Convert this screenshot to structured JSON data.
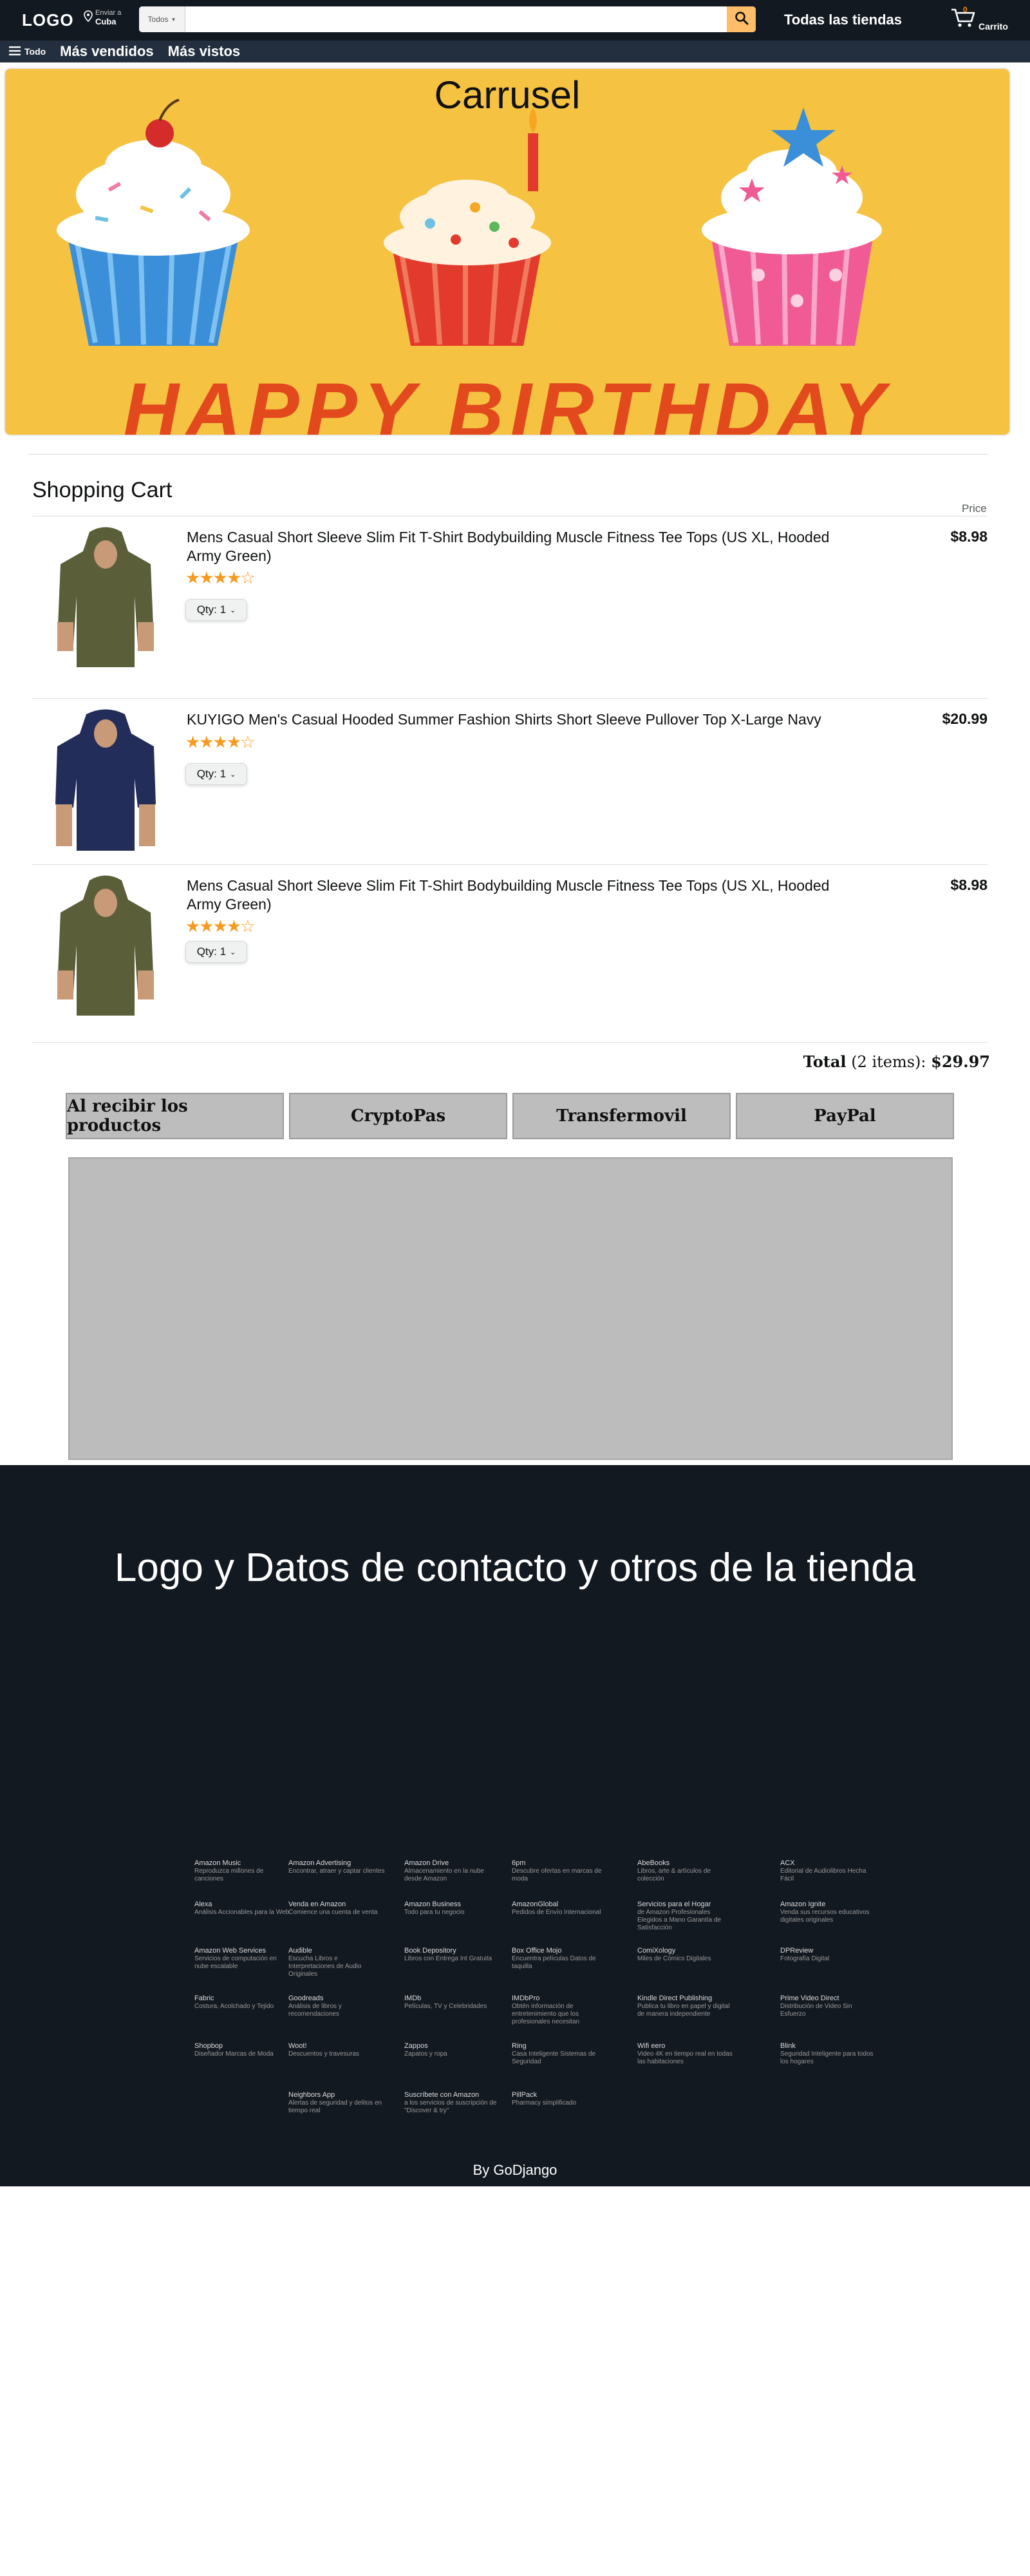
{
  "header": {
    "logo": "LOGO",
    "deliver_line1": "Enviar a",
    "deliver_line2": "Cuba",
    "search_category": "Todos",
    "search_value": "",
    "all_stores": "Todas las tiendas",
    "cart_count": "0",
    "cart_label": "Carrito"
  },
  "nav": {
    "todo": "Todo",
    "links": [
      "Más vendidos",
      "Más vistos"
    ]
  },
  "carousel": {
    "title": "Carrusel",
    "banner_text": "HAPPY BIRTHDAY"
  },
  "cart": {
    "title": "Shopping Cart",
    "price_header": "Price",
    "items": [
      {
        "name": "Mens Casual Short Sleeve Slim Fit T-Shirt Bodybuilding Muscle Fitness Tee Tops (US XL, Hooded Army Green)",
        "price": "$8.98",
        "rating": "4 de 5",
        "qty_label": "Qty: 1",
        "color": "#5a5f3a"
      },
      {
        "name": "KUYIGO Men's Casual Hooded Summer Fashion Shirts Short Sleeve Pullover Top X-Large Navy",
        "price": "$20.99",
        "rating": "4 de 5",
        "qty_label": "Qty: 1",
        "color": "#232d5a"
      },
      {
        "name": "Mens Casual Short Sleeve Slim Fit T-Shirt Bodybuilding Muscle Fitness Tee Tops (US XL, Hooded Army Green)",
        "price": "$8.98",
        "rating": "4 de 5",
        "qty_label": "Qty: 1",
        "color": "#5a5f3a"
      }
    ],
    "total_label": "Total",
    "total_items": "(2 items):",
    "total_amount": "$29.97"
  },
  "payment": {
    "tabs": [
      "Al recibir los productos",
      "CryptoPas",
      "Transfermovil",
      "PayPal"
    ]
  },
  "footer": {
    "headline": "Logo y Datos de contacto y otros de la tienda",
    "columns": [
      [
        {
          "h": "Amazon Music",
          "s": "Reproduzca millones de canciones"
        },
        {
          "h": "Alexa",
          "s": "Análisis Accionables para la Web"
        },
        {
          "h": "Amazon Web Services",
          "s": "Servicios de computación en nube escalable"
        },
        {
          "h": "Fabric",
          "s": "Costura, Acolchado y Tejido"
        },
        {
          "h": "Shopbop",
          "s": "Diseñador Marcas de Moda"
        }
      ],
      [
        {
          "h": "Amazon Advertising",
          "s": "Encontrar, atraer y captar clientes"
        },
        {
          "h": "Venda en Amazon",
          "s": "Comience una cuenta de venta"
        },
        {
          "h": "Audible",
          "s": "Escucha Libros e Interpretaciones de Audio Originales"
        },
        {
          "h": "Goodreads",
          "s": "Análisis de libros y recomendaciones"
        },
        {
          "h": "Woot!",
          "s": "Descuentos y travesuras"
        },
        {
          "h": "Neighbors App",
          "s": "Alertas de seguridad y delitos en tiempo real"
        }
      ],
      [
        {
          "h": "Amazon Drive",
          "s": "Almacenamiento en la nube desde Amazon"
        },
        {
          "h": "Amazon Business",
          "s": "Todo para tu negocio"
        },
        {
          "h": "Book Depository",
          "s": "Libros con Entrega Int Gratuita"
        },
        {
          "h": "IMDb",
          "s": "Películas, TV y Celebridades"
        },
        {
          "h": "Zappos",
          "s": "Zapatos y ropa"
        },
        {
          "h": "Suscríbete con Amazon",
          "s": "a los servicios de suscripción de \"Discover & try\""
        }
      ],
      [
        {
          "h": "6pm",
          "s": "Descubre ofertas en marcas de moda"
        },
        {
          "h": "AmazonGlobal",
          "s": "Pedidos de Envío Internacional"
        },
        {
          "h": "Box Office Mojo",
          "s": "Encuentra películas Datos de taquilla"
        },
        {
          "h": "IMDbPro",
          "s": "Obtén información de entretenimiento que los profesionales necesitan"
        },
        {
          "h": "Ring",
          "s": "Casa Inteligente Sistemas de Seguridad"
        },
        {
          "h": "PillPack",
          "s": "Pharmacy simplificado"
        }
      ],
      [
        {
          "h": "AbeBooks",
          "s": "Libros, arte & artículos de colección"
        },
        {
          "h": "Servicios para el Hogar",
          "s": "de Amazon Profesionales Elegidos a Mano Garantía de Satisfacción"
        },
        {
          "h": "ComiXology",
          "s": "Miles de Cómics Digitales"
        },
        {
          "h": "Kindle Direct Publishing",
          "s": "Publica tu libro en papel y digital de manera independiente"
        },
        {
          "h": "Wifi eero",
          "s": "Video 4K en tiempo real en todas las habitaciones"
        }
      ],
      [
        {
          "h": "ACX",
          "s": "Editorial de Audiolibros Hecha Fácil"
        },
        {
          "h": "Amazon Ignite",
          "s": "Venda sus recursos educativos digitales originales"
        },
        {
          "h": "DPReview",
          "s": "Fotografía Digital"
        },
        {
          "h": "Prime Video Direct",
          "s": "Distribución de Video Sin Esfuerzo"
        },
        {
          "h": "Blink",
          "s": "Seguridad Inteligente para todos los hogares"
        }
      ]
    ],
    "credit": "By GoDjango"
  },
  "colors": {
    "topbar": "#131921",
    "navbar": "#232f3e",
    "search_button": "#febd69",
    "star": "#f69a21",
    "carousel_bg": "#f5c242",
    "payment_tab": "#bdbdbd"
  }
}
